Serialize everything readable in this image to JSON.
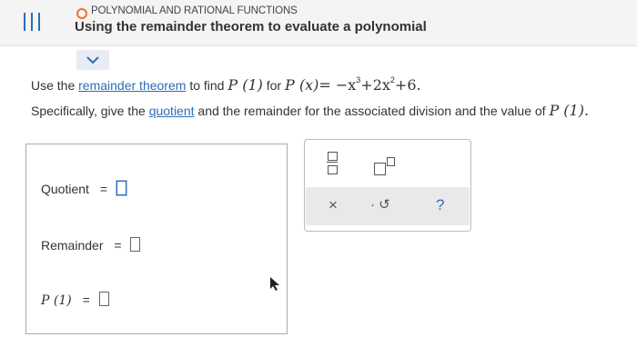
{
  "header": {
    "topic": "POLYNOMIAL AND RATIONAL FUNCTIONS",
    "title": "Using the remainder theorem to evaluate a polynomial"
  },
  "colors": {
    "accent": "#2c6db5",
    "topic_circle": "#e8732c"
  },
  "question": {
    "line1_prefix": "Use the",
    "line1_link": "remainder theorem",
    "line1_middle": "to find",
    "p_of_1": "P (1)",
    "line1_for": "for",
    "polynomial_lhs": "P (x)",
    "polynomial_rhs_1": "= −x",
    "polynomial_exp_1": "3",
    "polynomial_rhs_2": "+2x",
    "polynomial_exp_2": "2",
    "polynomial_rhs_3": "+6.",
    "line2_prefix": "Specifically, give the",
    "line2_link": "quotient",
    "line2_suffix": "and the remainder for the associated division and the value of",
    "line2_end": "P (1)."
  },
  "answers": {
    "quotient_label": "Quotient",
    "remainder_label": "Remainder",
    "p1_label": "P (1)",
    "equals": "="
  },
  "toolbar": {
    "icons": [
      "fraction-icon",
      "exponent-icon"
    ],
    "clear": "×",
    "undo": "↺",
    "help": "?"
  }
}
